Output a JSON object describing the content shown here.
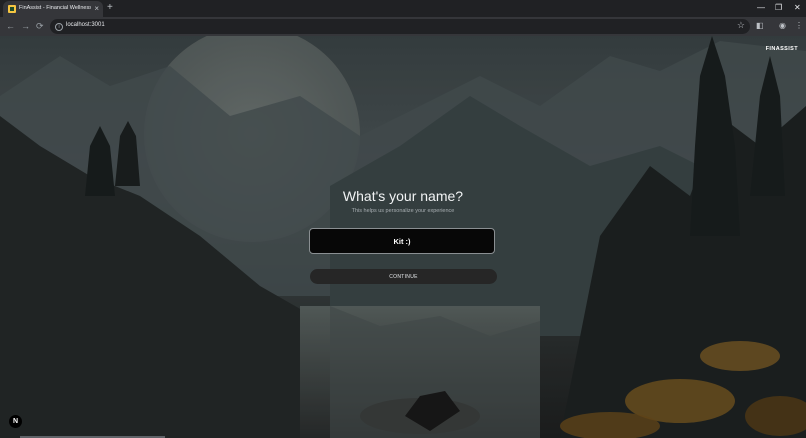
{
  "browser": {
    "tab_title": "FinAssist - Financial Wellness A",
    "url": "localhost:3001",
    "icons": {
      "new_tab": "+",
      "tab_close": "×",
      "minimize": "—",
      "maximize": "❐",
      "close": "✕",
      "back": "←",
      "forward": "→",
      "reload": "⟳",
      "info": "i",
      "bookmark": "☆",
      "side_panel": "◧",
      "profile": "◉",
      "menu": "⋮"
    }
  },
  "page": {
    "brand": "FINASSIST",
    "question": "What's your name?",
    "subtitle": "This helps us personalize your experience",
    "name_value": "Kit :)",
    "continue_label": "CONTINUE",
    "dev_badge": "N"
  }
}
